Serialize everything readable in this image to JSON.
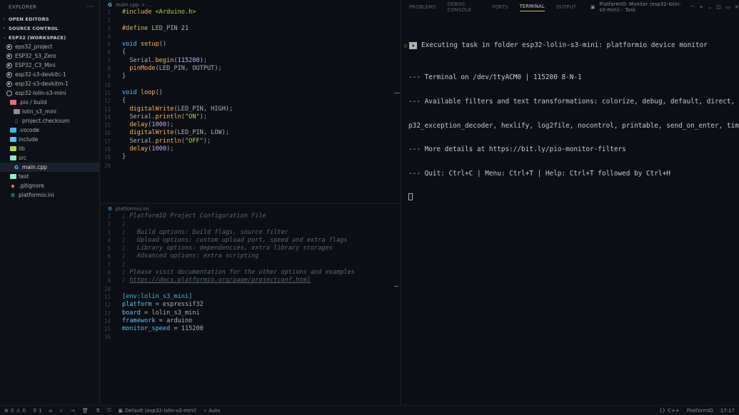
{
  "sidebar": {
    "title": "EXPLORER",
    "more": "···",
    "sections": {
      "open_editors": "OPEN EDITORS",
      "source_control": "SOURCE CONTROL",
      "workspace": "ESP32 (WORKSPACE)"
    },
    "projects": [
      "eps32_project",
      "ESP32_S3_Zero",
      "ESP32_C3_Mini",
      "esp32-s3-devkitc-1",
      "esp32-s3-devkitm-1",
      "esp32-lolin-s3-mini"
    ],
    "files": {
      "pio_build": ".pio / build",
      "lolin": "lolin_s3_mini",
      "checksum": "project.checksum",
      "vscode": ".vscode",
      "include": "include",
      "lib": "lib",
      "src": "src",
      "main": "main.cpp",
      "test": "test",
      "gitignore": ".gitignore",
      "platformio": "platformio.ini"
    }
  },
  "editor1": {
    "tab": "main.cpp",
    "breadcrumb": "> ...",
    "line_numbers": [
      "1",
      "2",
      "3",
      "4",
      "5",
      "6",
      "7",
      "8",
      "9",
      "10",
      "11",
      "12",
      "13",
      "14",
      "15",
      "16",
      "17",
      "18",
      "19",
      "20"
    ]
  },
  "editor2": {
    "tab": "platformio.ini",
    "line_numbers": [
      "1",
      "2",
      "3",
      "4",
      "5",
      "6",
      "7",
      "8",
      "9",
      "10",
      "11",
      "12",
      "13",
      "14",
      "15",
      "16"
    ]
  },
  "panel": {
    "tabs": [
      "PROBLEMS",
      "DEBUG CONSOLE",
      "PORTS",
      "TERMINAL",
      "OUTPUT"
    ],
    "task": "PlatformIO: Monitor (esp32-lolin-s3-mini) - Task",
    "exec": "Executing task in folder esp32-lolin-s3-mini: platformio device monitor",
    "terminal_lines": [
      "--- Terminal on /dev/ttyACM0 | 115200 8-N-1",
      "--- Available filters and text transformations: colorize, debug, default, direct, es",
      "p32_exception_decoder, hexlify, log2file, nocontrol, printable, send_on_enter, time",
      "--- More details at https://bit.ly/pio-monitor-filters",
      "--- Quit: Ctrl+C | Menu: Ctrl+T | Help: Ctrl+T followed by Ctrl+H"
    ]
  },
  "statusbar": {
    "errors": "0",
    "warnings": "0",
    "ports": "1",
    "env": "Default (esp32-lolin-s3-mini)",
    "auto": "Auto",
    "lang": "C++",
    "pio": "PlatformIO",
    "time": "17:17"
  },
  "colors": {
    "accent": "#e6b450",
    "background": "#0b0e14"
  }
}
